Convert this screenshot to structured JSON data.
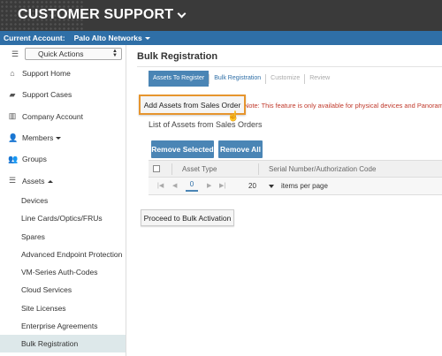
{
  "app": {
    "title": "CUSTOMER SUPPORT"
  },
  "account": {
    "label": "Current Account:",
    "name": "Palo Alto Networks"
  },
  "sidebar": {
    "quick_actions": "Quick Actions",
    "items": [
      {
        "label": "Support Home",
        "icon": "home-icon"
      },
      {
        "label": "Support Cases",
        "icon": "briefcase-icon"
      },
      {
        "label": "Company Account",
        "icon": "building-icon"
      },
      {
        "label": "Members",
        "icon": "user-plus-icon"
      },
      {
        "label": "Groups",
        "icon": "users-icon"
      },
      {
        "label": "Assets",
        "icon": "list-icon"
      }
    ],
    "sub_items": [
      "Devices",
      "Line Cards/Optics/FRUs",
      "Spares",
      "Advanced Endpoint Protection",
      "VM-Series Auth-Codes",
      "Cloud Services",
      "Site Licenses",
      "Enterprise Agreements",
      "Bulk Registration"
    ]
  },
  "main": {
    "title": "Bulk Registration",
    "wizard": [
      "Assets To Register",
      "Bulk Registration",
      "Customize",
      "Review"
    ],
    "add_button": "Add Assets from Sales Order",
    "note": "Note: This feature is only available for physical devices and Panorama",
    "list_title": "List of Assets from Sales Orders",
    "remove_selected": "Remove Selected",
    "remove_all": "Remove All",
    "columns": [
      "Asset Type",
      "Serial Number/Authorization Code"
    ],
    "pager": {
      "page": "0",
      "page_size": "20",
      "label": "items per page"
    },
    "proceed_button": "Proceed to Bulk Activation"
  },
  "colors": {
    "accent": "#4a85b5",
    "account_bar": "#2f6fa7",
    "highlight": "#e6952e",
    "note": "#c0392b"
  }
}
